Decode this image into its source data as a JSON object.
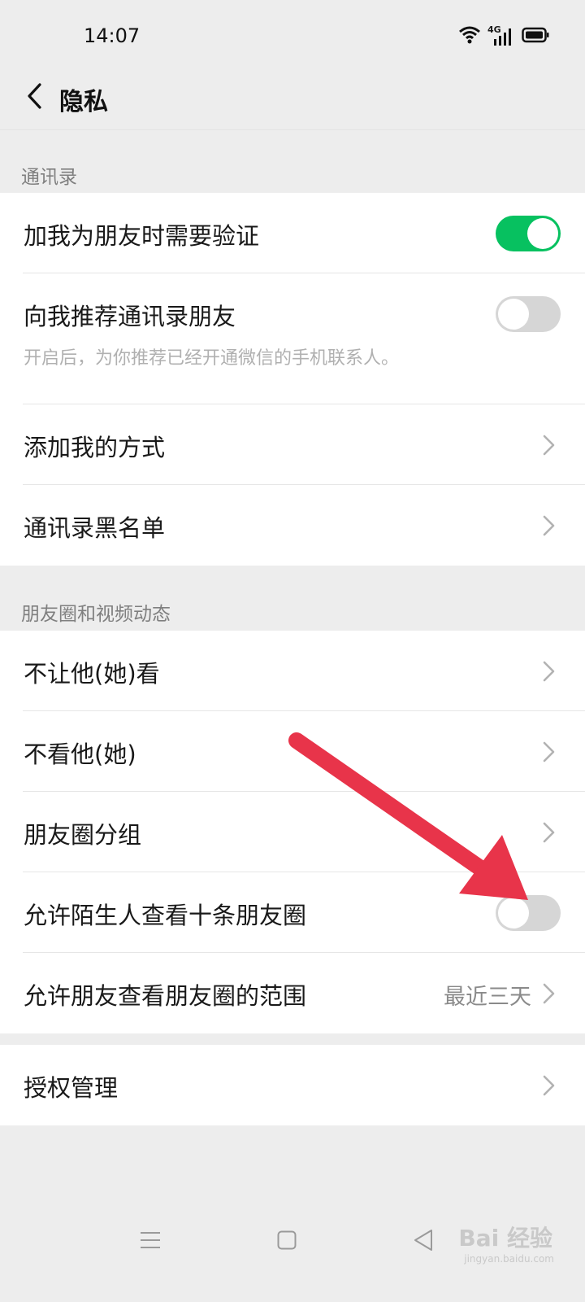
{
  "status_bar": {
    "time": "14:07",
    "network": "4G",
    "icons": [
      "wifi-icon",
      "signal-icon",
      "battery-icon"
    ]
  },
  "nav": {
    "title": "隐私",
    "back_icon": "chevron-left-icon"
  },
  "sections": {
    "contacts": {
      "header": "通讯录",
      "verify_label": "加我为朋友时需要验证",
      "verify_on": true,
      "recommend_label": "向我推荐通讯录朋友",
      "recommend_on": false,
      "recommend_desc": "开启后，为你推荐已经开通微信的手机联系人。",
      "add_methods_label": "添加我的方式",
      "blacklist_label": "通讯录黑名单"
    },
    "moments": {
      "header": "朋友圈和视频动态",
      "dont_let_see_label": "不让他(她)看",
      "dont_see_label": "不看他(她)",
      "groups_label": "朋友圈分组",
      "stranger_label": "允许陌生人查看十条朋友圈",
      "stranger_on": false,
      "range_label": "允许朋友查看朋友圈的范围",
      "range_value": "最近三天"
    },
    "auth": {
      "label": "授权管理"
    }
  },
  "bottom_nav": {
    "icons": [
      "menu-icon",
      "home-icon",
      "back-icon"
    ]
  },
  "watermark": {
    "brand": "Bai 经验",
    "url": "jingyan.baidu.com"
  },
  "colors": {
    "background": "#ededed",
    "toggle_on": "#07c160",
    "toggle_off": "#d6d6d6",
    "annotation_arrow": "#e8344a"
  }
}
